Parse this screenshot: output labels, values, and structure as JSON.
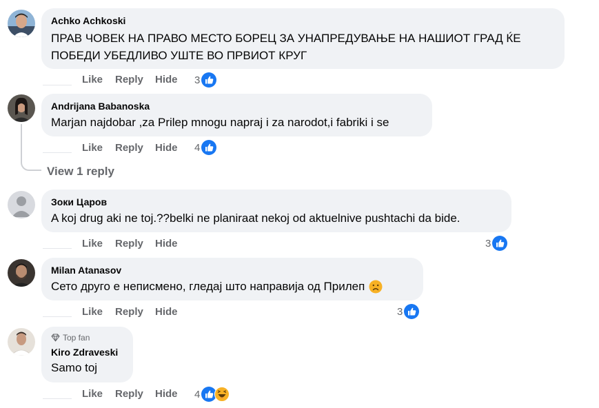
{
  "comments": [
    {
      "author": "Achko Achkoski",
      "text_lines": [
        "ПРАВ ЧОВЕК НА ПРАВО МЕСТО БОРЕЦ ЗА УНАПРЕДУВАЊЕ НА НАШИОТ ГРАД ЌЕ",
        "ПОБЕДИ УБЕДЛИВО УШТЕ ВО ПРВИОТ КРУГ"
      ],
      "actions": {
        "like": "Like",
        "reply": "Reply",
        "hide": "Hide"
      },
      "reaction_count": "3",
      "reactions": [
        "like-icon"
      ]
    },
    {
      "author": "Andrijana Babanoska",
      "text_lines": [
        "Marjan najdobar ,za Prilep mnogu napraj i za narodot,i fabriki i se"
      ],
      "actions": {
        "like": "Like",
        "reply": "Reply",
        "hide": "Hide"
      },
      "reaction_count": "4",
      "reactions": [
        "like-icon"
      ],
      "view_replies": "View 1 reply"
    },
    {
      "author": "Зоки Царов",
      "text_lines": [
        "A koj drug aki ne toj.??belki ne planiraat nekoj od aktuelnive pushtachi da bide."
      ],
      "actions": {
        "like": "Like",
        "reply": "Reply",
        "hide": "Hide"
      },
      "reaction_count": "3",
      "reactions": [
        "like-icon"
      ]
    },
    {
      "author": "Milan Atanasov",
      "text_lines": [
        "Сето друго е неписмено, гледај што направија од Прилеп"
      ],
      "emoji": "sad-face-emoji",
      "actions": {
        "like": "Like",
        "reply": "Reply",
        "hide": "Hide"
      },
      "reaction_count": "3",
      "reactions": [
        "like-icon"
      ]
    },
    {
      "badge": "Top fan",
      "author": "Kiro Zdraveski",
      "text_lines": [
        "Samo toj"
      ],
      "actions": {
        "like": "Like",
        "reply": "Reply",
        "hide": "Hide"
      },
      "reaction_count": "4",
      "reactions": [
        "like-icon",
        "haha-icon"
      ]
    }
  ],
  "colors": {
    "bubble": "#f0f2f5",
    "secondary_text": "#65676b",
    "like_blue": "#1877f2",
    "haha_yellow": "#f7b125"
  }
}
